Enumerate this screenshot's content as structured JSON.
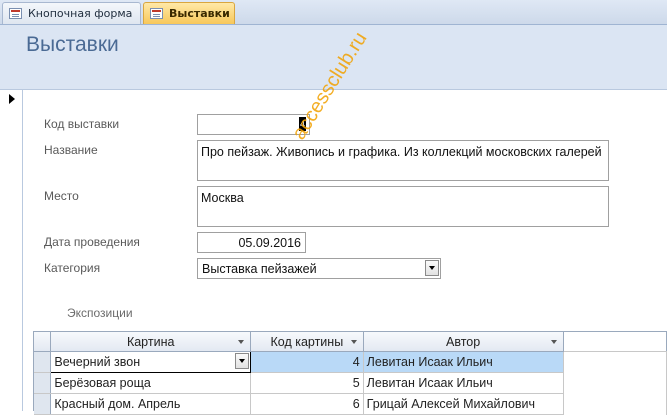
{
  "tabs": [
    {
      "label": "Кнопочная форма",
      "active": false
    },
    {
      "label": "Выставки",
      "active": true
    }
  ],
  "form": {
    "title": "Выставки",
    "fields": {
      "code": {
        "label": "Код выставки",
        "value": "4"
      },
      "name": {
        "label": "Название",
        "value": "Про пейзаж. Живопись и графика. Из коллекций московских галерей"
      },
      "place": {
        "label": "Место",
        "value": "Москва"
      },
      "date": {
        "label": "Дата проведения",
        "value": "05.09.2016"
      },
      "category": {
        "label": "Категория",
        "value": "Выставка пейзажей"
      }
    },
    "watermark": "accessclub.ru"
  },
  "subform": {
    "label": "Экспозиции",
    "columns": [
      "Картина",
      "Код картины",
      "Автор"
    ],
    "rows": [
      {
        "picture": "Вечерний звон",
        "code": "4",
        "author": "Левитан Исаак Ильич"
      },
      {
        "picture": "Берёзовая роща",
        "code": "5",
        "author": "Левитан Исаак Ильич"
      },
      {
        "picture": "Красный дом. Апрель",
        "code": "6",
        "author": "Грицай Алексей Михайлович"
      }
    ]
  },
  "colors": {
    "active_tab": "#f7c75a",
    "header_band": "#dbe5f3",
    "title": "#4a6a94",
    "selected_cell": "#b9d9f7"
  }
}
